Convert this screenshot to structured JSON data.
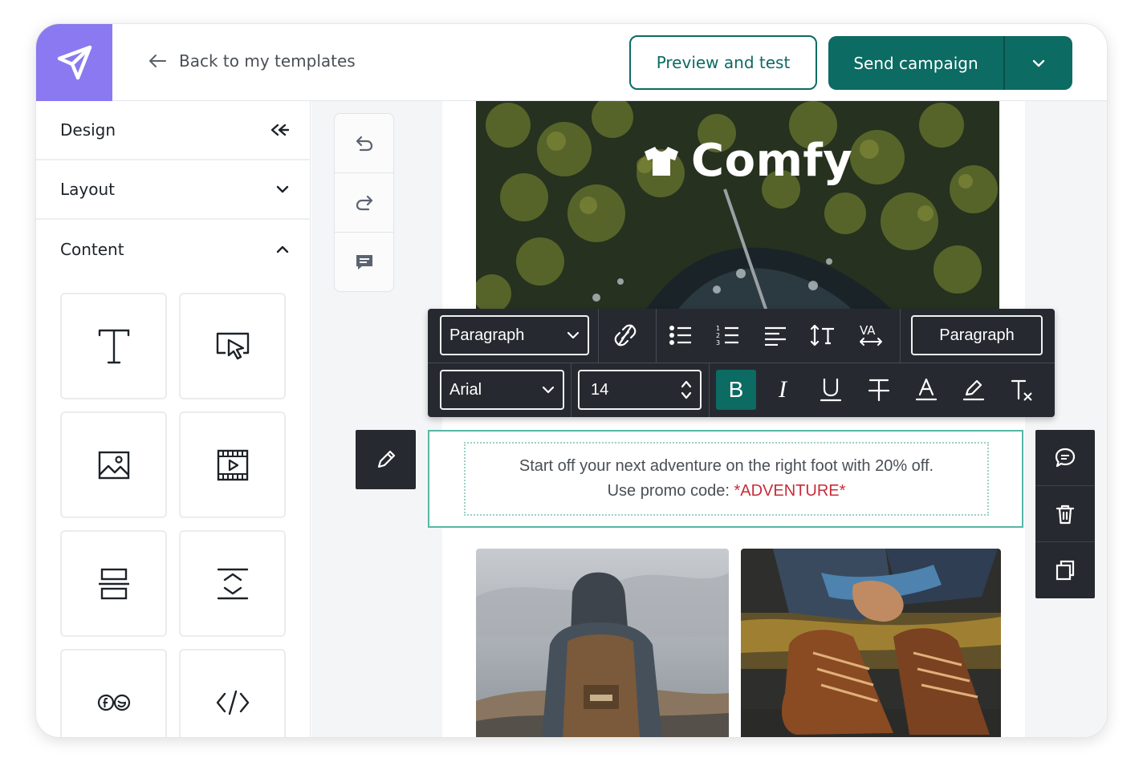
{
  "header": {
    "back_label": "Back to my templates",
    "preview_label": "Preview and test",
    "send_label": "Send campaign"
  },
  "sidebar": {
    "design_label": "Design",
    "layout_label": "Layout",
    "content_label": "Content",
    "tiles": [
      {
        "name": "text-block",
        "icon": "text-icon"
      },
      {
        "name": "button-block",
        "icon": "button-cursor-icon"
      },
      {
        "name": "image-block",
        "icon": "image-icon"
      },
      {
        "name": "video-block",
        "icon": "video-icon"
      },
      {
        "name": "divider-block",
        "icon": "divider-icon"
      },
      {
        "name": "spacer-block",
        "icon": "spacer-icon"
      },
      {
        "name": "social-block",
        "icon": "social-icon"
      },
      {
        "name": "html-block",
        "icon": "code-icon"
      }
    ]
  },
  "email": {
    "brand_name": "Comfy",
    "body_line1": "Start off your next adventure on the right foot with 20% off.",
    "body_line2": "Use promo code:",
    "promo_code": "*ADVENTURE*"
  },
  "toolbar": {
    "block_type": "Paragraph",
    "style_label": "Paragraph",
    "font_family": "Arial",
    "font_size": "14",
    "bold_label": "B",
    "italic_label": "I",
    "underline_label": "U",
    "va_label": "VA"
  },
  "colors": {
    "accent": "#0c6b63",
    "logo_bg": "#8a79f0",
    "toolbar_bg": "#262a30",
    "selection_border": "#56b7a6",
    "promo_text": "#c62d3a"
  }
}
